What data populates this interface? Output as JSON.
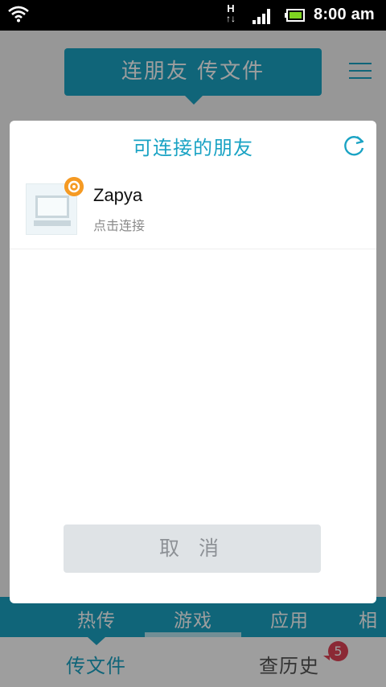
{
  "statusbar": {
    "network_type": "H",
    "time": "8:00 am"
  },
  "header": {
    "title": "连朋友 传文件"
  },
  "tabs": [
    {
      "label": "热传"
    },
    {
      "label": "游戏"
    },
    {
      "label": "应用"
    },
    {
      "label": "相机"
    }
  ],
  "bottom_nav": {
    "transfer_label": "传文件",
    "history_label": "查历史",
    "history_badge": "5"
  },
  "dialog": {
    "title": "可连接的朋友",
    "friends": [
      {
        "name": "Zapya",
        "status": "点击连接"
      }
    ],
    "cancel_label": "取 消"
  },
  "colors": {
    "accent": "#1aa3c4",
    "badge_orange": "#f59a23",
    "badge_red": "#e04356"
  }
}
